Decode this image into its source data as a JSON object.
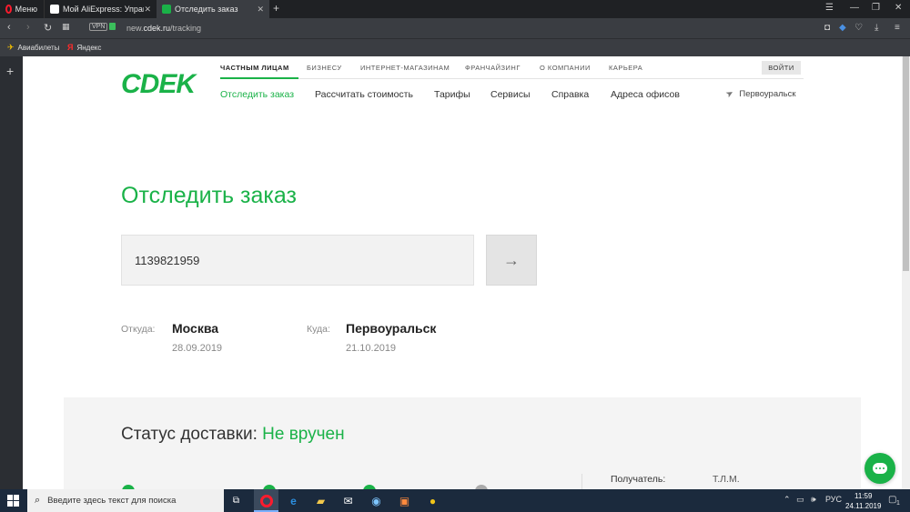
{
  "browser": {
    "menu_label": "Меню",
    "tabs": [
      {
        "title": "Мой AliExpress: Управлят"
      },
      {
        "title": "Отследить заказ"
      }
    ],
    "url_prefix": "new.",
    "url_domain": "cdek.ru",
    "url_path": "/tracking",
    "vpn_label": "VPN",
    "bookmarks": [
      {
        "label": "Авиабилеты"
      },
      {
        "label": "Яндекс"
      }
    ]
  },
  "site": {
    "logo": "CDEK",
    "top_nav": [
      "ЧАСТНЫМ ЛИЦАМ",
      "БИЗНЕСУ",
      "ИНТЕРНЕТ-МАГАЗИНАМ",
      "ФРАНЧАЙЗИНГ",
      "О КОМПАНИИ",
      "КАРЬЕРА"
    ],
    "login_label": "ВОЙТИ",
    "sub_nav": [
      "Отследить заказ",
      "Рассчитать стоимость",
      "Тарифы",
      "Сервисы",
      "Справка",
      "Адреса офисов"
    ],
    "city": "Первоуральск"
  },
  "tracking": {
    "heading": "Отследить заказ",
    "number": "1139821959",
    "from_label": "Откуда:",
    "from_city": "Москва",
    "from_date": "28.09.2019",
    "to_label": "Куда:",
    "to_city": "Первоуральск",
    "to_date": "21.10.2019"
  },
  "status": {
    "title_prefix": "Статус доставки: ",
    "title_value": "Не вручен",
    "recipient_label": "Получатель:",
    "recipient_value": "Т.Л.М."
  },
  "taskbar": {
    "search_placeholder": "Введите здесь текст для поиска",
    "lang": "РУС",
    "time": "11:59",
    "date": "24.11.2019",
    "notif_count": "1"
  },
  "colors": {
    "brand_green": "#1ab248"
  }
}
